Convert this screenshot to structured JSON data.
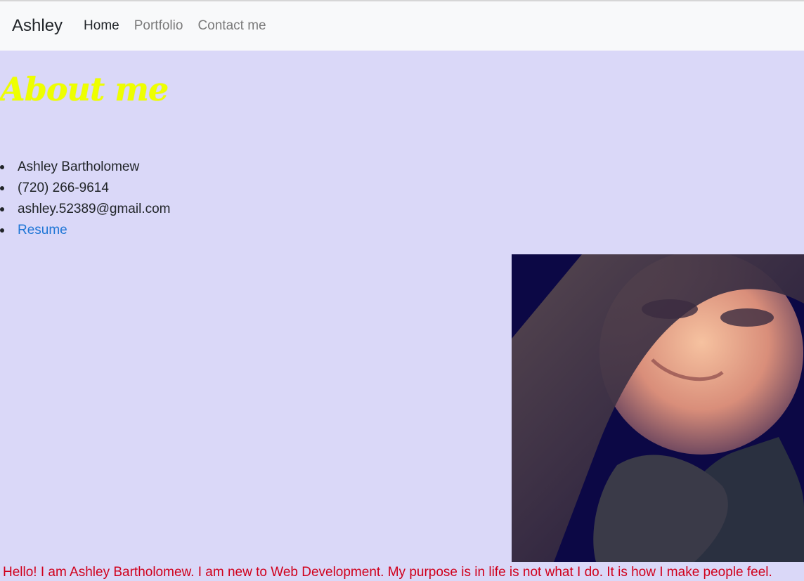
{
  "navbar": {
    "brand": "Ashley",
    "links": [
      {
        "label": "Home",
        "active": true
      },
      {
        "label": "Portfolio",
        "active": false
      },
      {
        "label": "Contact me",
        "active": false
      }
    ]
  },
  "about": {
    "title": "About me",
    "items": {
      "name": "Ashley Bartholomew",
      "phone": "(720) 266-9614",
      "email": "ashley.52389@gmail.com",
      "resume": "Resume"
    }
  },
  "intro": "Hello! I am Ashley Bartholomew. I am new to Web Development. My purpose is in life is not what I do. It is how I make people feel.",
  "colors": {
    "page_background": "#dad8f8",
    "title": "#eeff00",
    "intro_text": "#d0001c",
    "link": "#1f76d6"
  }
}
